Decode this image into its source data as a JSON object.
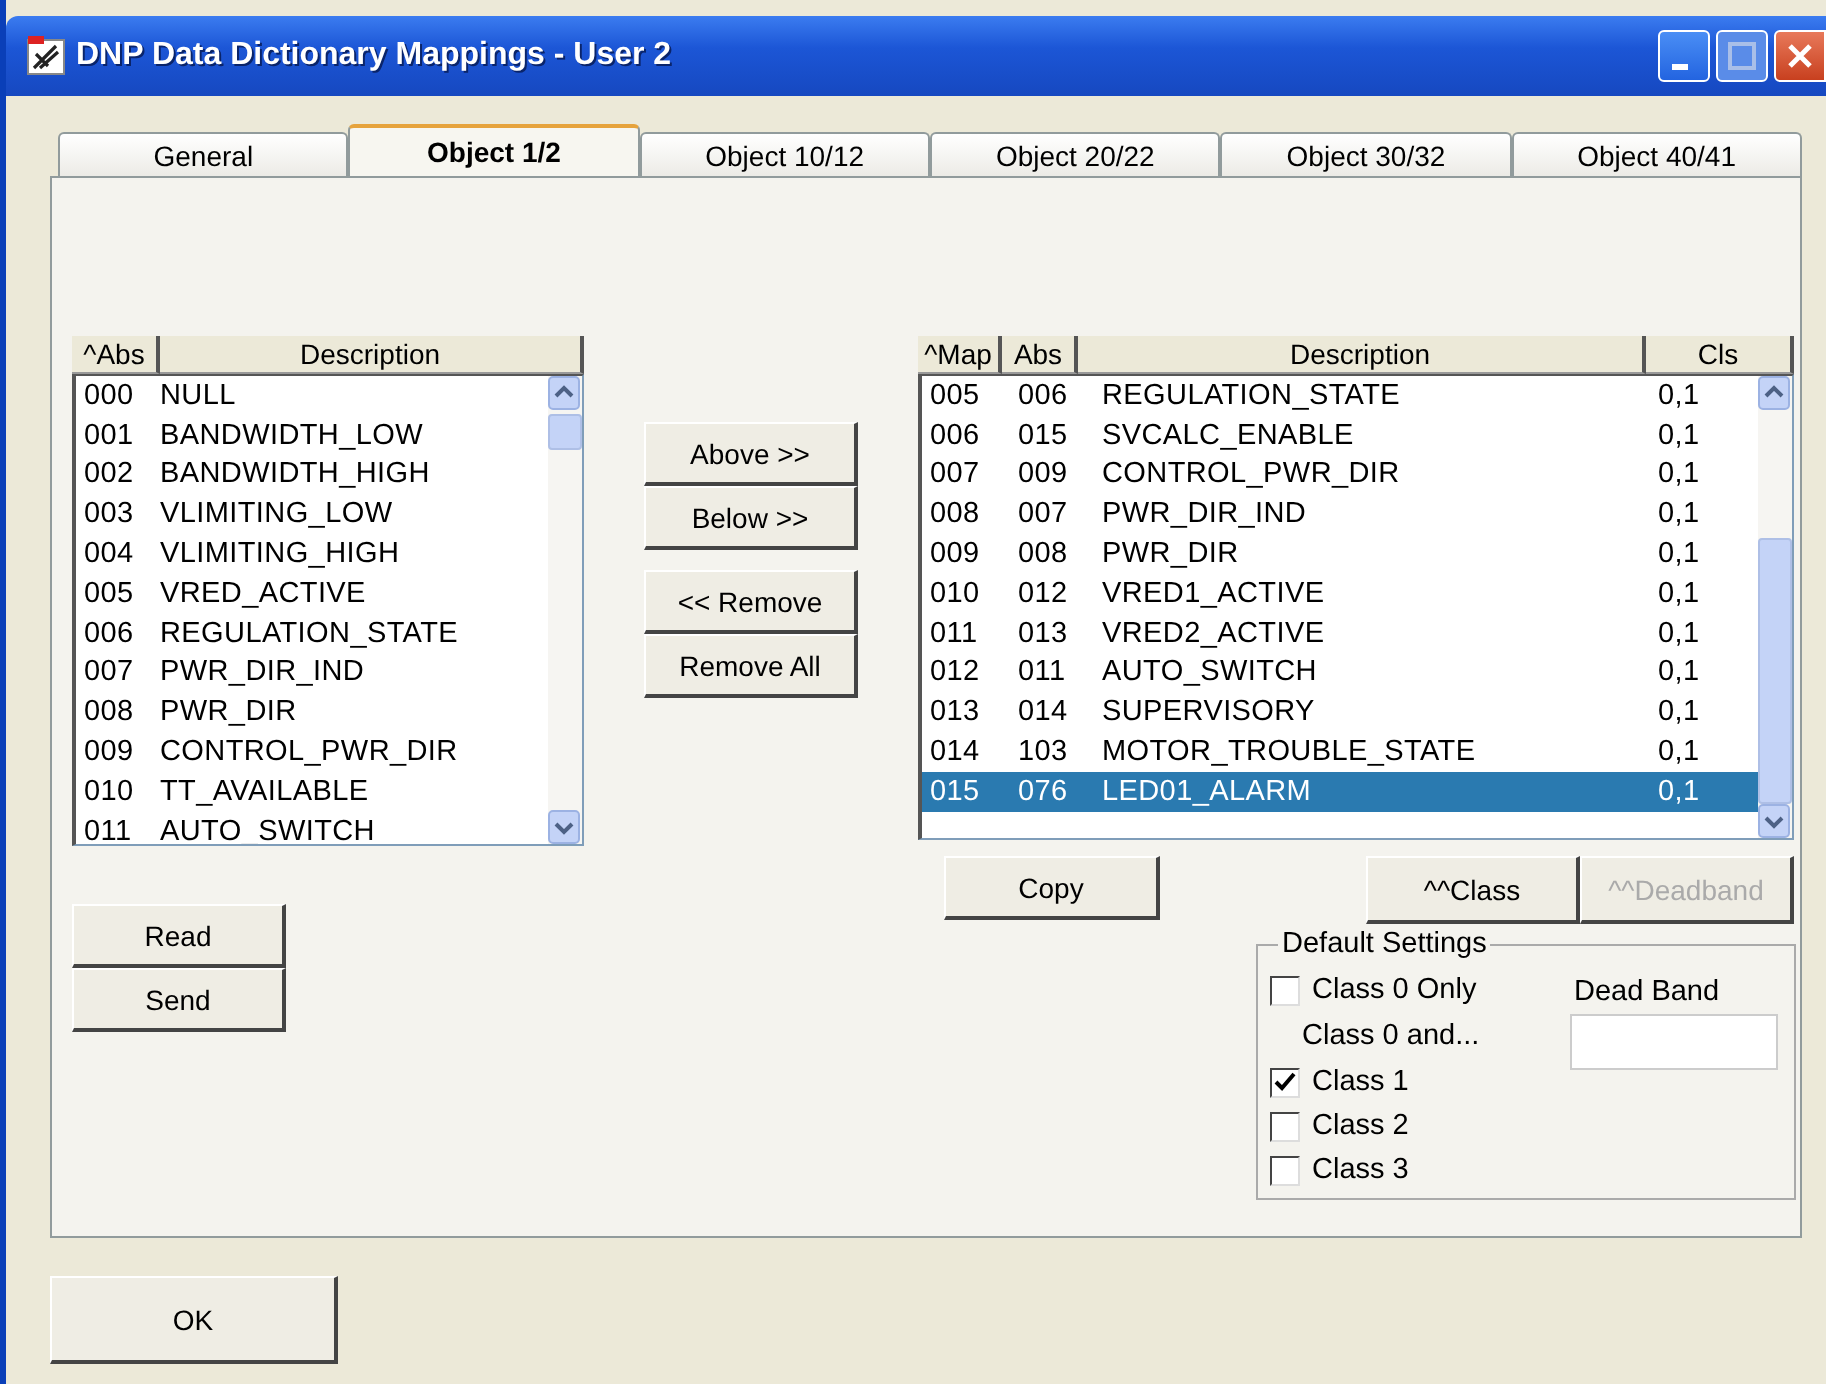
{
  "window": {
    "title": "DNP Data Dictionary Mappings - User 2"
  },
  "tabs": [
    {
      "label": "General",
      "selected": false
    },
    {
      "label": "Object 1/2",
      "selected": true
    },
    {
      "label": "Object 10/12",
      "selected": false
    },
    {
      "label": "Object 20/22",
      "selected": false
    },
    {
      "label": "Object 30/32",
      "selected": false
    },
    {
      "label": "Object 40/41",
      "selected": false
    }
  ],
  "dictionary_list": {
    "columns": [
      "^Abs",
      "Description"
    ],
    "rows": [
      {
        "abs": "000",
        "description": "NULL",
        "selected": false
      },
      {
        "abs": "001",
        "description": "BANDWIDTH_LOW",
        "selected": false
      },
      {
        "abs": "002",
        "description": "BANDWIDTH_HIGH",
        "selected": false
      },
      {
        "abs": "003",
        "description": "VLIMITING_LOW",
        "selected": false
      },
      {
        "abs": "004",
        "description": "VLIMITING_HIGH",
        "selected": false
      },
      {
        "abs": "005",
        "description": "VRED_ACTIVE",
        "selected": false
      },
      {
        "abs": "006",
        "description": "REGULATION_STATE",
        "selected": false
      },
      {
        "abs": "007",
        "description": "PWR_DIR_IND",
        "selected": false
      },
      {
        "abs": "008",
        "description": "PWR_DIR",
        "selected": false
      },
      {
        "abs": "009",
        "description": "CONTROL_PWR_DIR",
        "selected": false
      },
      {
        "abs": "010",
        "description": "TT_AVAILABLE",
        "selected": false
      },
      {
        "abs": "011",
        "description": "AUTO_SWITCH",
        "selected": false
      }
    ]
  },
  "move_buttons": [
    [
      "Above >>",
      "Below >>"
    ],
    [
      "<< Remove",
      "Remove All"
    ]
  ],
  "left_buttons": [
    "Read",
    "Send"
  ],
  "mapping_list": {
    "columns": [
      "^Map",
      "Abs",
      "Description",
      "Cls"
    ],
    "rows": [
      {
        "map": "005",
        "abs": "006",
        "description": "REGULATION_STATE",
        "cls": "0,1",
        "selected": false
      },
      {
        "map": "006",
        "abs": "015",
        "description": "SVCALC_ENABLE",
        "cls": "0,1",
        "selected": false
      },
      {
        "map": "007",
        "abs": "009",
        "description": "CONTROL_PWR_DIR",
        "cls": "0,1",
        "selected": false
      },
      {
        "map": "008",
        "abs": "007",
        "description": "PWR_DIR_IND",
        "cls": "0,1",
        "selected": false
      },
      {
        "map": "009",
        "abs": "008",
        "description": "PWR_DIR",
        "cls": "0,1",
        "selected": false
      },
      {
        "map": "010",
        "abs": "012",
        "description": "VRED1_ACTIVE",
        "cls": "0,1",
        "selected": false
      },
      {
        "map": "011",
        "abs": "013",
        "description": "VRED2_ACTIVE",
        "cls": "0,1",
        "selected": false
      },
      {
        "map": "012",
        "abs": "011",
        "description": "AUTO_SWITCH",
        "cls": "0,1",
        "selected": false
      },
      {
        "map": "013",
        "abs": "014",
        "description": "SUPERVISORY",
        "cls": "0,1",
        "selected": false
      },
      {
        "map": "014",
        "abs": "103",
        "description": "MOTOR_TROUBLE_STATE",
        "cls": "0,1",
        "selected": false
      },
      {
        "map": "015",
        "abs": "076",
        "description": "LED01_ALARM",
        "cls": "0,1",
        "selected": true
      }
    ]
  },
  "copy_button": "Copy",
  "class_buttons": [
    {
      "label": "^^Class",
      "disabled": false
    },
    {
      "label": "^^Deadband",
      "disabled": true
    }
  ],
  "default_settings": {
    "title": "Default Settings",
    "class0_only": {
      "label": "Class 0 Only",
      "checked": false
    },
    "class0_and_label": "Class 0 and...",
    "classes": [
      {
        "label": "Class 1",
        "checked": true
      },
      {
        "label": "Class 2",
        "checked": false
      },
      {
        "label": "Class 3",
        "checked": false
      }
    ],
    "dead_band": {
      "label": "Dead Band"
    }
  },
  "ok_button": "OK"
}
